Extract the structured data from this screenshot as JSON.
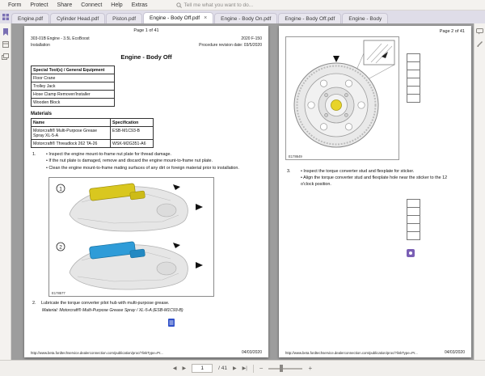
{
  "icons": {
    "close": "×"
  },
  "menubar": {
    "items": [
      "Form",
      "Protect",
      "Share",
      "Connect",
      "Help",
      "Extras"
    ],
    "search_hint": "Tell me what you want to do..."
  },
  "tabs": [
    {
      "label": "Engine.pdf"
    },
    {
      "label": "Cylinder Head.pdf"
    },
    {
      "label": "Piston.pdf"
    },
    {
      "label": "Engine - Body Off.pdf",
      "active": true
    },
    {
      "label": "Engine - Body On.pdf"
    },
    {
      "label": "Engine - Body Off.pdf"
    },
    {
      "label": "Engine - Body"
    }
  ],
  "page1": {
    "page_label": "Page 1 of 41",
    "header": {
      "doc_code": "303-01B Engine - 3.5L EcoBoost",
      "section": "Installation",
      "model": "2020 F-150",
      "revision": "Procedure revision date: 03/5/2020"
    },
    "title": "Engine - Body Off",
    "tools_header": "Special Tool(s) / General Equipment",
    "tools": [
      "Floor Crane",
      "Trolley Jack",
      "Hose Clamp Remover/Installer",
      "Wooden Block"
    ],
    "materials_title": "Materials",
    "materials": {
      "headers": [
        "Name",
        "Specification"
      ],
      "rows": [
        [
          "Motorcraft® Multi-Purpose Grease Spray XL-5-A",
          "ESB-M1C93-B"
        ],
        [
          "Motorcraft® Threadlock 262 TA-26",
          "WSK-M2G351-A6"
        ]
      ]
    },
    "step1": {
      "number": "1.",
      "bullets": [
        "Inspect the engine mount-to-frame nut plate for thread damage.",
        "If the nut plate is damaged, remove and discard the engine mount-to-frame nut plate.",
        "Clean the engine mount-to-frame mating surfaces of any dirt or foreign material prior to installation."
      ]
    },
    "figure_callouts": [
      "1",
      "2"
    ],
    "figure_label": "E178577",
    "step2": {
      "number": "2.",
      "text": "Lubricate the torque converter pilot hub with multi-purpose grease.",
      "material": "Material: Motorcraft® Multi-Purpose Grease Spray / XL-5-A (ESB-M1C93-B)"
    },
    "footer_url": "http://www.beta.fordtechservice.dealerconnection.com/publication/proc/?linkType=Pr...",
    "footer_date": "04/03/2020"
  },
  "page2": {
    "page_label": "Page 2 of 41",
    "figure_label": "E178649",
    "step3": {
      "number": "3.",
      "bullets": [
        "Inspect the torque converter stud and flexplate for sticker.",
        "Align the torque converter stud and flexplate hole near the sticker to the 12 o'clock position."
      ]
    },
    "footer_url": "http://www.beta.fordtechservice.dealerconnection.com/publication/proc/?linkType=Pr...",
    "footer_date": "04/03/2020"
  },
  "statusbar": {
    "nav": {
      "prev": "◀",
      "next": "▶",
      "next2": "▶",
      "last": "▶|"
    },
    "page_value": "1",
    "page_total": "/ 41",
    "zoom_out": "−",
    "zoom_in": "+"
  }
}
